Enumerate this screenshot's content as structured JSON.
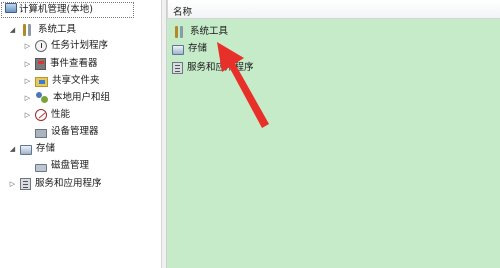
{
  "tree": {
    "root": "计算机管理(本地)",
    "system_tools": "系统工具",
    "items": [
      {
        "label": "任务计划程序",
        "icon": "clock-icon"
      },
      {
        "label": "事件查看器",
        "icon": "event-viewer-icon"
      },
      {
        "label": "共享文件夹",
        "icon": "shared-folder-icon"
      },
      {
        "label": "本地用户和组",
        "icon": "users-icon"
      },
      {
        "label": "性能",
        "icon": "performance-icon"
      },
      {
        "label": "设备管理器",
        "icon": "device-manager-icon"
      }
    ],
    "storage": "存储",
    "disk_management": "磁盘管理",
    "services": "服务和应用程序"
  },
  "list": {
    "header": "名称",
    "rows": [
      {
        "label": "系统工具"
      },
      {
        "label": "存储"
      },
      {
        "label": "服务和应用程序"
      }
    ]
  },
  "colors": {
    "content_bg": "#c6ebc9",
    "arrow": "#e8302a"
  }
}
